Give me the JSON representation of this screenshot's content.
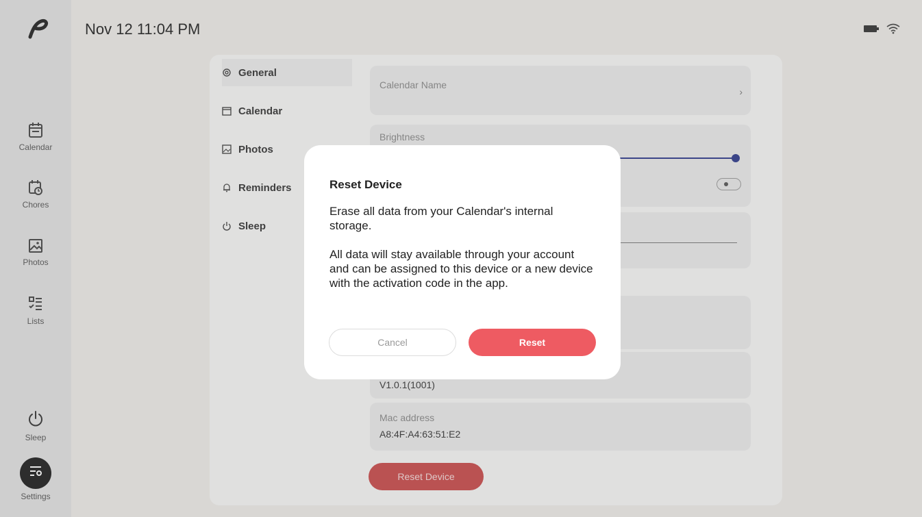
{
  "header": {
    "datetime": "Nov 12 11:04 PM",
    "status_icons": [
      "battery-icon",
      "wifi-icon"
    ]
  },
  "sidebar": {
    "items": [
      {
        "label": "Calendar",
        "icon": "calendar-icon"
      },
      {
        "label": "Chores",
        "icon": "chores-icon"
      },
      {
        "label": "Photos",
        "icon": "photos-icon"
      },
      {
        "label": "Lists",
        "icon": "lists-icon"
      },
      {
        "label": "Sleep",
        "icon": "power-icon"
      },
      {
        "label": "Settings",
        "icon": "settings-icon"
      }
    ]
  },
  "settings_menu": {
    "items": [
      {
        "label": "General",
        "icon": "gear-icon",
        "active": true
      },
      {
        "label": "Calendar",
        "icon": "calendar-icon"
      },
      {
        "label": "Photos",
        "icon": "photo-icon"
      },
      {
        "label": "Reminders",
        "icon": "bell-icon"
      },
      {
        "label": "Sleep",
        "icon": "power-icon"
      }
    ]
  },
  "general": {
    "calendar_name_label": "Calendar Name",
    "brightness_label": "Brightness",
    "brightness_level": 1.0,
    "version_value": "V1.0.1(1001)",
    "mac_label": "Mac address",
    "mac_value": "A8:4F:A4:63:51:E2",
    "reset_device_label": "Reset Device"
  },
  "modal": {
    "title": "Reset Device",
    "body_line1": "Erase all data from your Calendar's internal storage.",
    "body_line2": "All data will stay available through your account and can be assigned to this device or a new device with the activation code in the app.",
    "cancel_label": "Cancel",
    "reset_label": "Reset"
  },
  "colors": {
    "accent": "#ee5b62",
    "slider": "#2e3a8c"
  }
}
